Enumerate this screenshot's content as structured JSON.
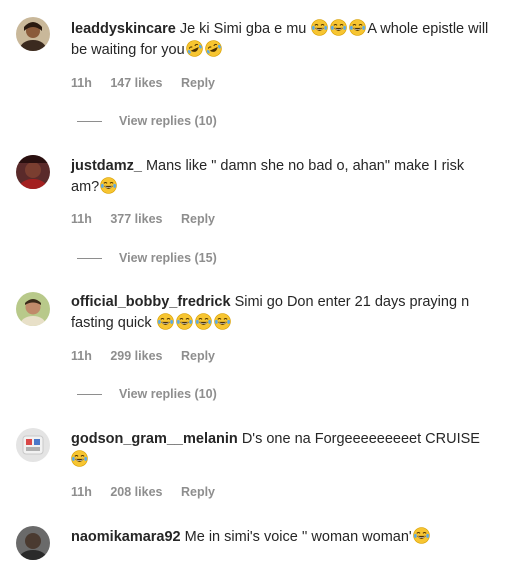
{
  "comments": [
    {
      "username": "leaddyskincare",
      "text_parts": [
        "Je ki Simi gba e mu ",
        "A whole epistle will be waiting for you"
      ],
      "emojis_a": [
        "joy-emoji",
        "joy-emoji",
        "joy-emoji"
      ],
      "emojis_b": [
        "rofl-emoji",
        "rofl-emoji"
      ],
      "time": "11h",
      "likes": "147 likes",
      "reply_label": "Reply",
      "view_replies": "View replies (10)"
    },
    {
      "username": "justdamz_",
      "text_parts": [
        "Mans like \" damn she no bad o, ahan\" make I risk am?"
      ],
      "emojis_a": [
        "joy-emoji"
      ],
      "time": "11h",
      "likes": "377 likes",
      "reply_label": "Reply",
      "view_replies": "View replies (15)"
    },
    {
      "username": "official_bobby_fredrick",
      "text_parts": [
        "Simi go Don enter 21 days praying n fasting quick "
      ],
      "emojis_a": [
        "joy-emoji",
        "joy-emoji",
        "joy-emoji",
        "joy-emoji"
      ],
      "time": "11h",
      "likes": "299 likes",
      "reply_label": "Reply",
      "view_replies": "View replies (10)"
    },
    {
      "username": "godson_gram__melanin",
      "text_parts": [
        "D's one na Forgeeeeeeeeet CRUISE"
      ],
      "emojis_a": [
        "joy-emoji"
      ],
      "time": "11h",
      "likes": "208 likes",
      "reply_label": "Reply"
    },
    {
      "username": "naomikamara92",
      "text_parts": [
        "Me in simi's voice '' woman woman'"
      ],
      "emojis_a": [
        "joy-emoji"
      ]
    }
  ],
  "colors": {
    "text": "#262626",
    "secondary": "#8e8e8e",
    "emoji_face": "#f7c531",
    "emoji_tear": "#5aa9e6"
  }
}
